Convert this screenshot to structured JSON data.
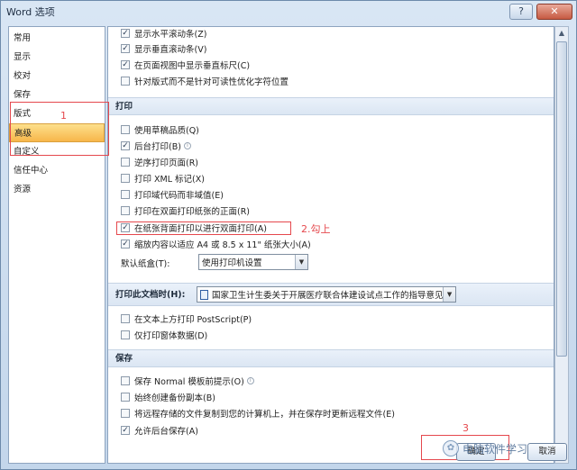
{
  "window": {
    "title": "Word 选项",
    "close_label": "?",
    "help_label": "✕"
  },
  "nav": {
    "items": [
      {
        "label": "常用"
      },
      {
        "label": "显示"
      },
      {
        "label": "校对"
      },
      {
        "label": "保存"
      },
      {
        "label": "版式"
      },
      {
        "label": "高级",
        "selected": true
      },
      {
        "label": "自定义"
      },
      {
        "label": "信任中心"
      },
      {
        "label": "资源"
      }
    ]
  },
  "display_options": [
    {
      "label": "显示水平滚动条(Z)",
      "checked": true
    },
    {
      "label": "显示垂直滚动条(V)",
      "checked": true
    },
    {
      "label": "在页面视图中显示垂直标尺(C)",
      "checked": true
    },
    {
      "label": "针对版式而不是针对可读性优化字符位置",
      "checked": false
    }
  ],
  "print": {
    "heading": "打印",
    "options": [
      {
        "label": "使用草稿品质(Q)",
        "checked": false
      },
      {
        "label": "后台打印(B)",
        "checked": true,
        "info": true
      },
      {
        "label": "逆序打印页面(R)",
        "checked": false
      },
      {
        "label": "打印 XML 标记(X)",
        "checked": false
      },
      {
        "label": "打印域代码而非域值(E)",
        "checked": false
      },
      {
        "label": "打印在双面打印纸张的正面(R)",
        "checked": false
      },
      {
        "label": "在纸张背面打印以进行双面打印(A)",
        "checked": true
      },
      {
        "label": "缩放内容以适应 A4 或 8.5 x 11\" 纸张大小(A)",
        "checked": true
      }
    ],
    "tray_label": "默认纸盒(T):",
    "tray_value": "使用打印机设置"
  },
  "print_doc": {
    "heading": "打印此文档时(H):",
    "doc_value": "国家卫生计生委关于开展医疗联合体建设试点工作的指导意见",
    "options": [
      {
        "label": "在文本上方打印 PostScript(P)",
        "checked": false
      },
      {
        "label": "仅打印窗体数据(D)",
        "checked": false
      }
    ]
  },
  "save": {
    "heading": "保存",
    "options": [
      {
        "label": "保存 Normal 模板前提示(O)",
        "checked": false,
        "info": true
      },
      {
        "label": "始终创建备份副本(B)",
        "checked": false
      },
      {
        "label": "将远程存储的文件复制到您的计算机上，并在保存时更新远程文件(E)",
        "checked": false
      },
      {
        "label": "允许后台保存(A)",
        "checked": true
      }
    ]
  },
  "annotations": {
    "one": "1",
    "two": "2.勾上",
    "three": "3"
  },
  "buttons": {
    "ok": "确定",
    "cancel": "取消"
  },
  "watermark": "电脑软件学习",
  "colors": {
    "selected_nav": "#f7b64a",
    "annotation": "#e5484d"
  }
}
